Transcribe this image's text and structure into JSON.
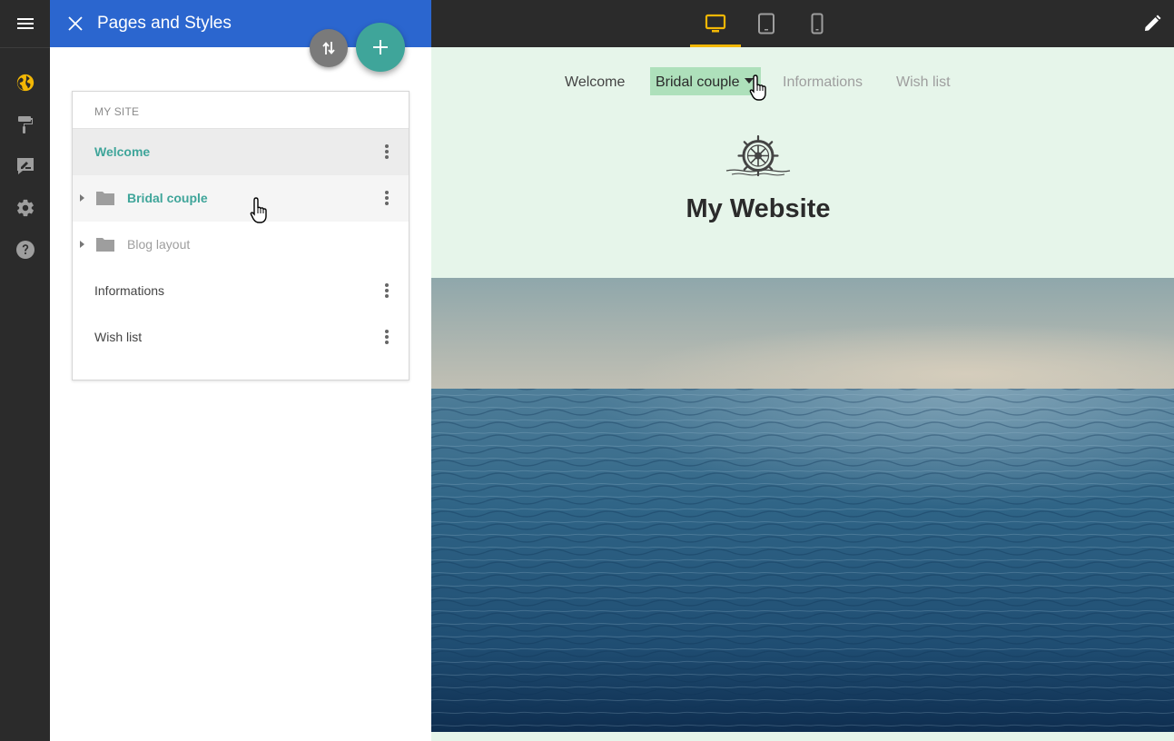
{
  "app": {
    "panel_title": "Pages and Styles"
  },
  "rail": {
    "items": [
      {
        "icon": "globe-icon",
        "active": true
      },
      {
        "icon": "paint-roller-icon",
        "active": false
      },
      {
        "icon": "signature-icon",
        "active": false
      },
      {
        "icon": "gear-icon",
        "active": false
      },
      {
        "icon": "help-icon",
        "active": false
      }
    ],
    "active_color": "#f2b705"
  },
  "tree": {
    "header": "MY SITE",
    "rows": [
      {
        "label": "Welcome",
        "color": "#3fa59a",
        "has_folder": false,
        "has_menu": true
      },
      {
        "label": "Bridal couple",
        "color": "#3fa59a",
        "has_folder": true,
        "has_menu": true
      },
      {
        "label": "Blog layout",
        "color": "#9e9e9e",
        "has_folder": true,
        "has_menu": false
      },
      {
        "label": "Informations",
        "color": "#444444",
        "has_folder": false,
        "has_menu": true
      },
      {
        "label": "Wish list",
        "color": "#444444",
        "has_folder": false,
        "has_menu": true
      }
    ]
  },
  "toolbar": {
    "devices": [
      "desktop-icon",
      "tablet-icon",
      "phone-icon"
    ],
    "active_device": "desktop-icon",
    "edit_icon": "pencil-icon"
  },
  "preview": {
    "nav": {
      "items": [
        "Welcome",
        "Bridal couple",
        "Informations",
        "Wish list"
      ],
      "active": "Bridal couple"
    },
    "site_title": "My Website",
    "logo_icon": "ship-wheel-icon",
    "hero": "ocean-image"
  },
  "colors": {
    "header_blue": "#2b66cf",
    "accent_teal": "#3fa59a",
    "preview_bg": "#e6f5ea",
    "nav_active_bg": "#aee0bb"
  }
}
